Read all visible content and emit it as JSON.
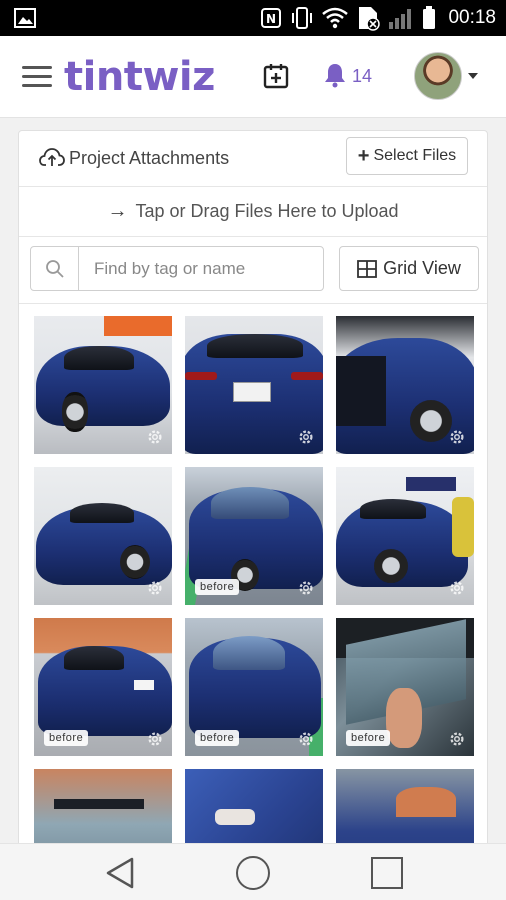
{
  "status_bar": {
    "time": "00:18"
  },
  "header": {
    "logo_part1": "tint",
    "logo_part2": "wiz",
    "notification_count": "14"
  },
  "attachments": {
    "title": "Project Attachments",
    "select_files_label": "Select Files",
    "dropzone_text": "Tap or Drag Files Here to Upload",
    "search_placeholder": "Find by tag or name",
    "search_value": "",
    "view_toggle_label": "Grid View"
  },
  "photos": [
    {
      "tag": ""
    },
    {
      "tag": ""
    },
    {
      "tag": ""
    },
    {
      "tag": ""
    },
    {
      "tag": "before"
    },
    {
      "tag": ""
    },
    {
      "tag": "before"
    },
    {
      "tag": "before"
    },
    {
      "tag": "before"
    },
    {
      "tag": ""
    },
    {
      "tag": ""
    },
    {
      "tag": ""
    }
  ],
  "colors": {
    "brand": "#7a5fc4",
    "car_blue": "#1c2f72"
  },
  "icons": [
    "photo-icon",
    "nfc-icon",
    "vibrate-icon",
    "wifi-icon",
    "signal-icon",
    "battery-icon",
    "menu-icon",
    "calendar-add-icon",
    "bell-icon",
    "upload-cloud-icon",
    "plus-icon",
    "arrow-right-icon",
    "search-icon",
    "grid-icon",
    "gear-icon",
    "back-icon",
    "home-icon",
    "recents-icon"
  ]
}
